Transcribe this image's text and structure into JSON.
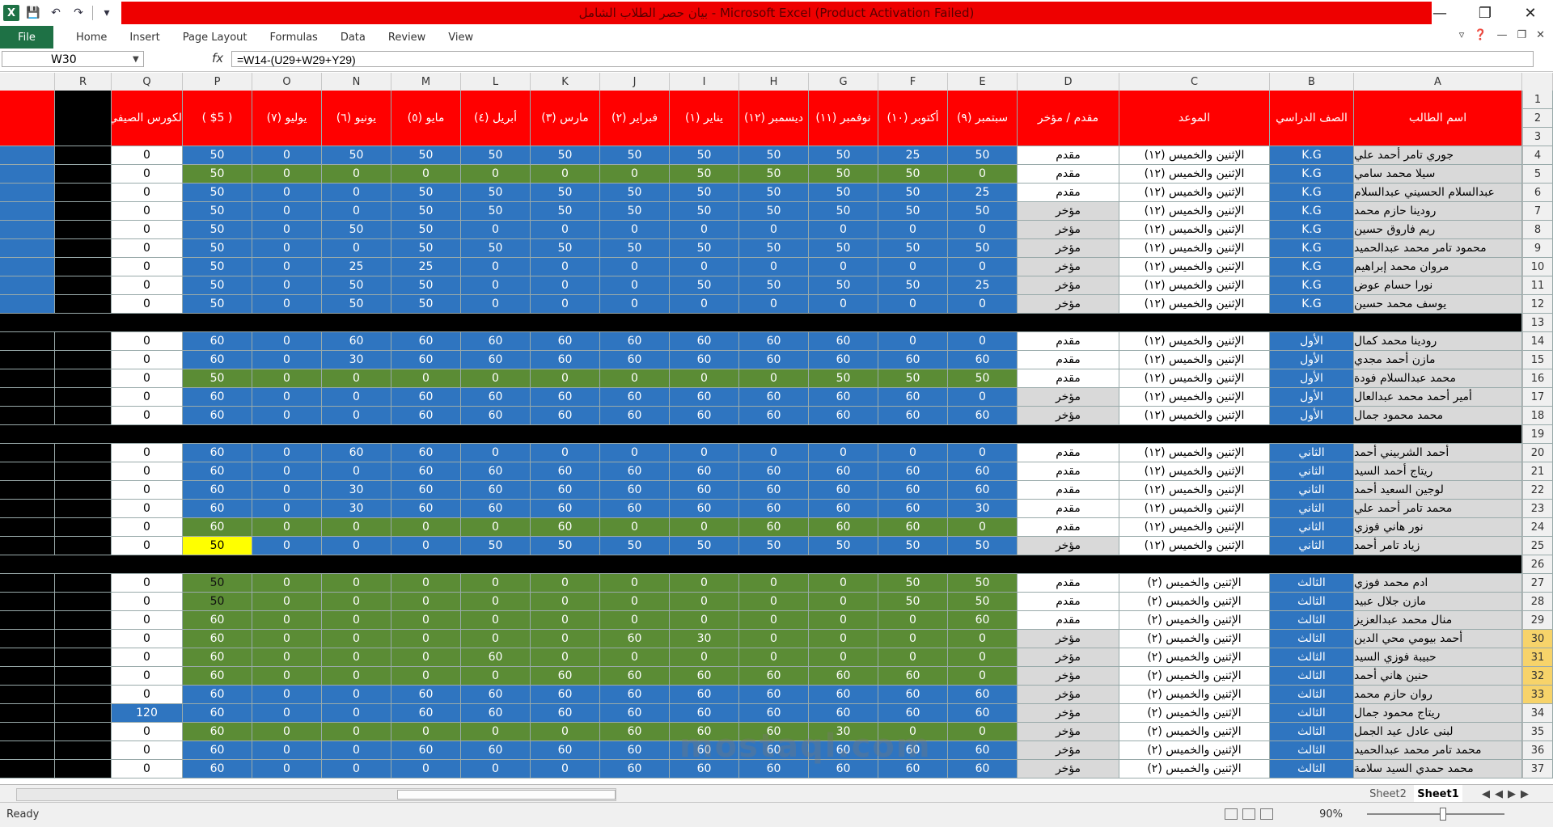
{
  "window": {
    "title": "بيان حصر الطلاب الشامل - Microsoft Excel (Product Activation Failed)",
    "colors": {
      "title_bar": "#ee0000",
      "file_tab": "#1e7145"
    }
  },
  "ribbon": {
    "file": "File",
    "tabs": [
      "Home",
      "Insert",
      "Page Layout",
      "Formulas",
      "Data",
      "Review",
      "View"
    ]
  },
  "formula_bar": {
    "name_box": "W30",
    "fx": "fx",
    "formula": "=W14-(U29+W29+Y29)"
  },
  "columns": [
    "R",
    "Q",
    "P",
    "O",
    "N",
    "M",
    "L",
    "K",
    "J",
    "I",
    "H",
    "G",
    "F",
    "E",
    "D",
    "C",
    "B",
    "A"
  ],
  "headers": {
    "Q": "الكورس الصيفي",
    "P": "( $5 )",
    "O": "يوليو (٧)",
    "N": "يونيو (٦)",
    "M": "مايو (٥)",
    "L": "أبريل (٤)",
    "K": "مارس (٣)",
    "J": "فبراير (٢)",
    "I": "يناير (١)",
    "H": "ديسمبر (١٢)",
    "G": "نوفمبر (١١)",
    "F": "أكتوبر (١٠)",
    "E": "سبتمبر (٩)",
    "D": "مقدم / مؤخر",
    "C": "الموعد",
    "B": "الصف الدراسي",
    "A": "اسم الطالب"
  },
  "rows": [
    {
      "n": 4,
      "A": "جوري تامر أحمد علي",
      "B": "K.G",
      "C": "الإثنين والخميس (١٢)",
      "D": "مقدم",
      "E": "50",
      "F": "25",
      "G": "50",
      "H": "50",
      "I": "50",
      "J": "50",
      "K": "50",
      "L": "50",
      "M": "50",
      "N": "50",
      "O": "0",
      "P": "50",
      "Q": "0",
      "fill": "blue",
      "dfill": "white"
    },
    {
      "n": 5,
      "A": "سيلا محمد سامي",
      "B": "K.G",
      "C": "الإثنين والخميس (١٢)",
      "D": "مقدم",
      "E": "0",
      "F": "50",
      "G": "50",
      "H": "50",
      "I": "50",
      "J": "0",
      "K": "0",
      "L": "0",
      "M": "0",
      "N": "0",
      "O": "0",
      "P": "50",
      "Q": "0",
      "fill": "green",
      "dfill": "white"
    },
    {
      "n": 6,
      "A": "عبدالسلام الحسيني عبدالسلام",
      "B": "K.G",
      "C": "الإثنين والخميس (١٢)",
      "D": "مقدم",
      "E": "25",
      "F": "50",
      "G": "50",
      "H": "50",
      "I": "50",
      "J": "50",
      "K": "50",
      "L": "50",
      "M": "50",
      "N": "0",
      "O": "0",
      "P": "50",
      "Q": "0",
      "fill": "blue",
      "dfill": "white"
    },
    {
      "n": 7,
      "A": "رودينا حازم محمد",
      "B": "K.G",
      "C": "الإثنين والخميس (١٢)",
      "D": "مؤخر",
      "E": "50",
      "F": "50",
      "G": "50",
      "H": "50",
      "I": "50",
      "J": "50",
      "K": "50",
      "L": "50",
      "M": "50",
      "N": "0",
      "O": "0",
      "P": "50",
      "Q": "0",
      "fill": "blue",
      "dfill": "gray"
    },
    {
      "n": 8,
      "A": "ريم فاروق حسين",
      "B": "K.G",
      "C": "الإثنين والخميس (١٢)",
      "D": "مؤخر",
      "E": "0",
      "F": "0",
      "G": "0",
      "H": "0",
      "I": "0",
      "J": "0",
      "K": "0",
      "L": "0",
      "M": "50",
      "N": "50",
      "O": "0",
      "P": "50",
      "Q": "0",
      "fill": "blue",
      "dfill": "gray"
    },
    {
      "n": 9,
      "A": "محمود تامر محمد عبدالحميد",
      "B": "K.G",
      "C": "الإثنين والخميس (١٢)",
      "D": "مؤخر",
      "E": "50",
      "F": "50",
      "G": "50",
      "H": "50",
      "I": "50",
      "J": "50",
      "K": "50",
      "L": "50",
      "M": "50",
      "N": "0",
      "O": "0",
      "P": "50",
      "Q": "0",
      "fill": "blue",
      "dfill": "gray"
    },
    {
      "n": 10,
      "A": "مروان محمد إبراهيم",
      "B": "K.G",
      "C": "الإثنين والخميس (١٢)",
      "D": "مؤخر",
      "E": "0",
      "F": "0",
      "G": "0",
      "H": "0",
      "I": "0",
      "J": "0",
      "K": "0",
      "L": "0",
      "M": "25",
      "N": "25",
      "O": "0",
      "P": "50",
      "Q": "0",
      "fill": "blue",
      "dfill": "gray"
    },
    {
      "n": 11,
      "A": "نورا حسام عوض",
      "B": "K.G",
      "C": "الإثنين والخميس (١٢)",
      "D": "مؤخر",
      "E": "25",
      "F": "50",
      "G": "50",
      "H": "50",
      "I": "50",
      "J": "0",
      "K": "0",
      "L": "0",
      "M": "50",
      "N": "50",
      "O": "0",
      "P": "50",
      "Q": "0",
      "fill": "blue",
      "dfill": "gray"
    },
    {
      "n": 12,
      "A": "يوسف محمد حسين",
      "B": "K.G",
      "C": "الإثنين والخميس (١٢)",
      "D": "مؤخر",
      "E": "0",
      "F": "0",
      "G": "0",
      "H": "0",
      "I": "0",
      "J": "0",
      "K": "0",
      "L": "0",
      "M": "50",
      "N": "50",
      "O": "0",
      "P": "50",
      "Q": "0",
      "fill": "blue",
      "dfill": "gray"
    },
    {
      "n": 13,
      "sep": true
    },
    {
      "n": 14,
      "A": "رودينا محمد كمال",
      "B": "الأول",
      "C": "الإثنين والخميس (١٢)",
      "D": "مقدم",
      "E": "0",
      "F": "0",
      "G": "60",
      "H": "60",
      "I": "60",
      "J": "60",
      "K": "60",
      "L": "60",
      "M": "60",
      "N": "60",
      "O": "0",
      "P": "60",
      "Q": "0",
      "fill": "blue",
      "dfill": "white"
    },
    {
      "n": 15,
      "A": "مازن أحمد مجدي",
      "B": "الأول",
      "C": "الإثنين والخميس (١٢)",
      "D": "مقدم",
      "E": "60",
      "F": "60",
      "G": "60",
      "H": "60",
      "I": "60",
      "J": "60",
      "K": "60",
      "L": "60",
      "M": "60",
      "N": "30",
      "O": "0",
      "P": "60",
      "Q": "0",
      "fill": "blue",
      "dfill": "white"
    },
    {
      "n": 16,
      "A": "محمد عبدالسلام فودة",
      "B": "الأول",
      "C": "الإثنين والخميس (١٢)",
      "D": "مقدم",
      "E": "50",
      "F": "50",
      "G": "50",
      "H": "0",
      "I": "0",
      "J": "0",
      "K": "0",
      "L": "0",
      "M": "0",
      "N": "0",
      "O": "0",
      "P": "50",
      "Q": "0",
      "fill": "green",
      "dfill": "white"
    },
    {
      "n": 17,
      "A": "أمير أحمد محمد عبدالعال",
      "B": "الأول",
      "C": "الإثنين والخميس (١٢)",
      "D": "مؤخر",
      "E": "0",
      "F": "60",
      "G": "60",
      "H": "60",
      "I": "60",
      "J": "60",
      "K": "60",
      "L": "60",
      "M": "60",
      "N": "0",
      "O": "0",
      "P": "60",
      "Q": "0",
      "fill": "blue",
      "dfill": "gray"
    },
    {
      "n": 18,
      "A": "محمد محمود جمال",
      "B": "الأول",
      "C": "الإثنين والخميس (١٢)",
      "D": "مؤخر",
      "E": "60",
      "F": "60",
      "G": "60",
      "H": "60",
      "I": "60",
      "J": "60",
      "K": "60",
      "L": "60",
      "M": "60",
      "N": "0",
      "O": "0",
      "P": "60",
      "Q": "0",
      "fill": "blue",
      "dfill": "gray"
    },
    {
      "n": 19,
      "sep": true
    },
    {
      "n": 20,
      "A": "أحمد الشربيني أحمد",
      "B": "الثاني",
      "C": "الإثنين والخميس (١٢)",
      "D": "مقدم",
      "E": "0",
      "F": "0",
      "G": "0",
      "H": "0",
      "I": "0",
      "J": "0",
      "K": "0",
      "L": "0",
      "M": "60",
      "N": "60",
      "O": "0",
      "P": "60",
      "Q": "0",
      "fill": "blue",
      "dfill": "white"
    },
    {
      "n": 21,
      "A": "ريتاج أحمد السيد",
      "B": "الثاني",
      "C": "الإثنين والخميس (١٢)",
      "D": "مقدم",
      "E": "60",
      "F": "60",
      "G": "60",
      "H": "60",
      "I": "60",
      "J": "60",
      "K": "60",
      "L": "60",
      "M": "60",
      "N": "0",
      "O": "0",
      "P": "60",
      "Q": "0",
      "fill": "blue",
      "dfill": "white"
    },
    {
      "n": 22,
      "A": "لوجين السعيد أحمد",
      "B": "الثاني",
      "C": "الإثنين والخميس (١٢)",
      "D": "مقدم",
      "E": "60",
      "F": "60",
      "G": "60",
      "H": "60",
      "I": "60",
      "J": "60",
      "K": "60",
      "L": "60",
      "M": "60",
      "N": "30",
      "O": "0",
      "P": "60",
      "Q": "0",
      "fill": "blue",
      "dfill": "white"
    },
    {
      "n": 23,
      "A": "محمد تامر أحمد علي",
      "B": "الثاني",
      "C": "الإثنين والخميس (١٢)",
      "D": "مقدم",
      "E": "30",
      "F": "60",
      "G": "60",
      "H": "60",
      "I": "60",
      "J": "60",
      "K": "60",
      "L": "60",
      "M": "60",
      "N": "30",
      "O": "0",
      "P": "60",
      "Q": "0",
      "fill": "blue",
      "dfill": "white"
    },
    {
      "n": 24,
      "A": "نور هاني فوزي",
      "B": "الثاني",
      "C": "الإثنين والخميس (١٢)",
      "D": "مقدم",
      "E": "0",
      "F": "60",
      "G": "60",
      "H": "60",
      "I": "0",
      "J": "0",
      "K": "60",
      "L": "0",
      "M": "0",
      "N": "0",
      "O": "0",
      "P": "60",
      "Q": "0",
      "fill": "green",
      "dfill": "white"
    },
    {
      "n": 25,
      "A": "زياد تامر أحمد",
      "B": "الثاني",
      "C": "الإثنين والخميس (١٢)",
      "D": "مؤخر",
      "E": "50",
      "F": "50",
      "G": "50",
      "H": "50",
      "I": "50",
      "J": "50",
      "K": "50",
      "L": "50",
      "M": "0",
      "N": "0",
      "O": "0",
      "P": "50",
      "Q": "0",
      "fill": "blue",
      "dfill": "gray",
      "pfill": "yellow"
    },
    {
      "n": 26,
      "sep": true
    },
    {
      "n": 27,
      "A": "ادم محمد فوزي",
      "B": "الثالث",
      "C": "الإثنين والخميس (٢)",
      "D": "مقدم",
      "E": "50",
      "F": "50",
      "G": "0",
      "H": "0",
      "I": "0",
      "J": "0",
      "K": "0",
      "L": "0",
      "M": "0",
      "N": "0",
      "O": "0",
      "P": "50",
      "Q": "0",
      "fill": "green",
      "dfill": "white",
      "pdark": true
    },
    {
      "n": 28,
      "A": "مازن جلال عبيد",
      "B": "الثالث",
      "C": "الإثنين والخميس (٢)",
      "D": "مقدم",
      "E": "50",
      "F": "50",
      "G": "0",
      "H": "0",
      "I": "0",
      "J": "0",
      "K": "0",
      "L": "0",
      "M": "0",
      "N": "0",
      "O": "0",
      "P": "50",
      "Q": "0",
      "fill": "green",
      "dfill": "white",
      "pdark": true
    },
    {
      "n": 29,
      "A": "منال محمد عبدالعزيز",
      "B": "الثالث",
      "C": "الإثنين والخميس (٢)",
      "D": "مقدم",
      "E": "60",
      "F": "0",
      "G": "0",
      "H": "0",
      "I": "0",
      "J": "0",
      "K": "0",
      "L": "0",
      "M": "0",
      "N": "0",
      "O": "0",
      "P": "60",
      "Q": "0",
      "fill": "green",
      "dfill": "white"
    },
    {
      "n": 30,
      "A": "أحمد بيومي محي الدين",
      "B": "الثالث",
      "C": "الإثنين والخميس (٢)",
      "D": "مؤخر",
      "E": "0",
      "F": "0",
      "G": "0",
      "H": "0",
      "I": "30",
      "J": "60",
      "K": "0",
      "L": "0",
      "M": "0",
      "N": "0",
      "O": "0",
      "P": "60",
      "Q": "0",
      "fill": "green",
      "dfill": "gray",
      "sel": true
    },
    {
      "n": 31,
      "A": "حبيبة فوزي السيد",
      "B": "الثالث",
      "C": "الإثنين والخميس (٢)",
      "D": "مؤخر",
      "E": "0",
      "F": "0",
      "G": "0",
      "H": "0",
      "I": "0",
      "J": "0",
      "K": "0",
      "L": "60",
      "M": "0",
      "N": "0",
      "O": "0",
      "P": "60",
      "Q": "0",
      "fill": "green",
      "dfill": "gray",
      "sel": true
    },
    {
      "n": 32,
      "A": "حنين هاني أحمد",
      "B": "الثالث",
      "C": "الإثنين والخميس (٢)",
      "D": "مؤخر",
      "E": "0",
      "F": "60",
      "G": "60",
      "H": "60",
      "I": "60",
      "J": "60",
      "K": "60",
      "L": "0",
      "M": "0",
      "N": "0",
      "O": "0",
      "P": "60",
      "Q": "0",
      "fill": "green",
      "dfill": "gray",
      "sel": true
    },
    {
      "n": 33,
      "A": "روان حازم محمد",
      "B": "الثالث",
      "C": "الإثنين والخميس (٢)",
      "D": "مؤخر",
      "E": "60",
      "F": "60",
      "G": "60",
      "H": "60",
      "I": "60",
      "J": "60",
      "K": "60",
      "L": "60",
      "M": "60",
      "N": "0",
      "O": "0",
      "P": "60",
      "Q": "0",
      "fill": "blue",
      "dfill": "gray",
      "sel": true
    },
    {
      "n": 34,
      "A": "ريتاج محمود جمال",
      "B": "الثالث",
      "C": "الإثنين والخميس (٢)",
      "D": "مؤخر",
      "E": "60",
      "F": "60",
      "G": "60",
      "H": "60",
      "I": "60",
      "J": "60",
      "K": "60",
      "L": "60",
      "M": "60",
      "N": "0",
      "O": "0",
      "P": "60",
      "Q": "120",
      "fill": "blue",
      "dfill": "gray",
      "qfill": "blue"
    },
    {
      "n": 35,
      "A": "لبنى عادل عيد الجمل",
      "B": "الثالث",
      "C": "الإثنين والخميس (٢)",
      "D": "مؤخر",
      "E": "0",
      "F": "0",
      "G": "30",
      "H": "60",
      "I": "60",
      "J": "60",
      "K": "0",
      "L": "0",
      "M": "0",
      "N": "0",
      "O": "0",
      "P": "60",
      "Q": "0",
      "fill": "green",
      "dfill": "gray"
    },
    {
      "n": 36,
      "A": "محمد تامر محمد عبدالحميد",
      "B": "الثالث",
      "C": "الإثنين والخميس (٢)",
      "D": "مؤخر",
      "E": "60",
      "F": "60",
      "G": "60",
      "H": "60",
      "I": "60",
      "J": "60",
      "K": "60",
      "L": "60",
      "M": "60",
      "N": "0",
      "O": "0",
      "P": "60",
      "Q": "0",
      "fill": "blue",
      "dfill": "gray"
    },
    {
      "n": 37,
      "A": "محمد حمدي السيد سلامة",
      "B": "الثالث",
      "C": "الإثنين والخميس (٢)",
      "D": "مؤخر",
      "E": "60",
      "F": "60",
      "G": "60",
      "H": "60",
      "I": "60",
      "J": "60",
      "K": "0",
      "L": "0",
      "M": "0",
      "N": "0",
      "O": "0",
      "P": "60",
      "Q": "0",
      "fill": "blue",
      "dfill": "gray"
    }
  ],
  "sheet_tabs": [
    "Sheet2",
    "Sheet1"
  ],
  "active_sheet": "Sheet1",
  "status": {
    "ready": "Ready",
    "zoom": "90%"
  },
  "watermark": "mostaql.com"
}
